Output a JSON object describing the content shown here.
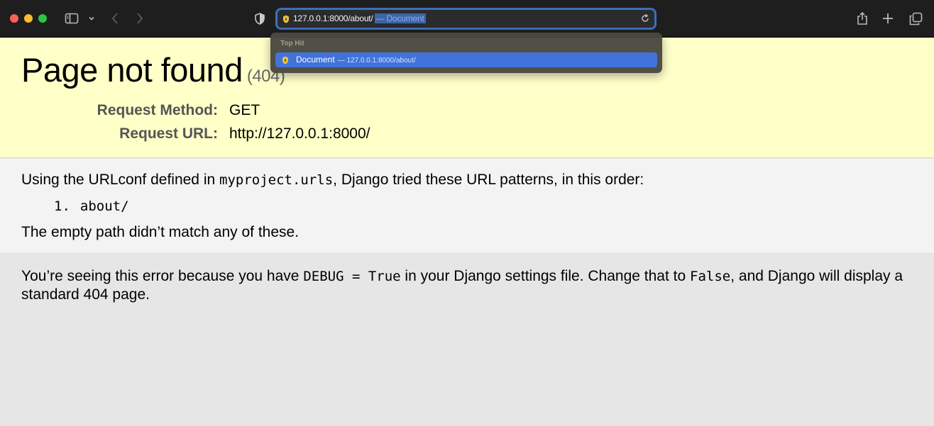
{
  "browser": {
    "address_url": "127.0.0.1:8000/about/",
    "address_suffix": "— Document",
    "colors": {
      "urlbar_focus": "#3d6fb8",
      "selection": "#3c6fdc"
    },
    "icons": [
      "close-window-icon",
      "minimize-window-icon",
      "zoom-window-icon",
      "sidebar-icon",
      "chevron-down-icon",
      "back-icon",
      "forward-icon",
      "shield-icon",
      "favicon-icon",
      "reload-icon",
      "share-icon",
      "new-tab-icon",
      "tab-overview-icon"
    ]
  },
  "autocomplete": {
    "header": "Top Hit",
    "item_title": "Document",
    "item_url": "— 127.0.0.1:8000/about/"
  },
  "page": {
    "title": "Page not found",
    "status_code": "(404)",
    "request_method_label": "Request Method:",
    "request_method": "GET",
    "request_url_label": "Request URL:",
    "request_url": "http://127.0.0.1:8000/",
    "urlconf_intro_before": "Using the URLconf defined in ",
    "urlconf_module": "myproject.urls",
    "urlconf_intro_after": ", Django tried these URL patterns, in this order:",
    "patterns": [
      {
        "number": "1.",
        "pattern": "about/"
      }
    ],
    "no_match": "The empty path didn’t match any of these.",
    "debug_before": "You’re seeing this error because you have ",
    "debug_code": "DEBUG = True",
    "debug_middle": " in your Django settings file. Change that to ",
    "debug_false": "False",
    "debug_after": ", and Django will display a standard 404 page.",
    "colors": {
      "summary_bg": "#ffffc8",
      "info_bg": "#f3f3f3",
      "explanation_bg": "#e6e6e6"
    }
  }
}
